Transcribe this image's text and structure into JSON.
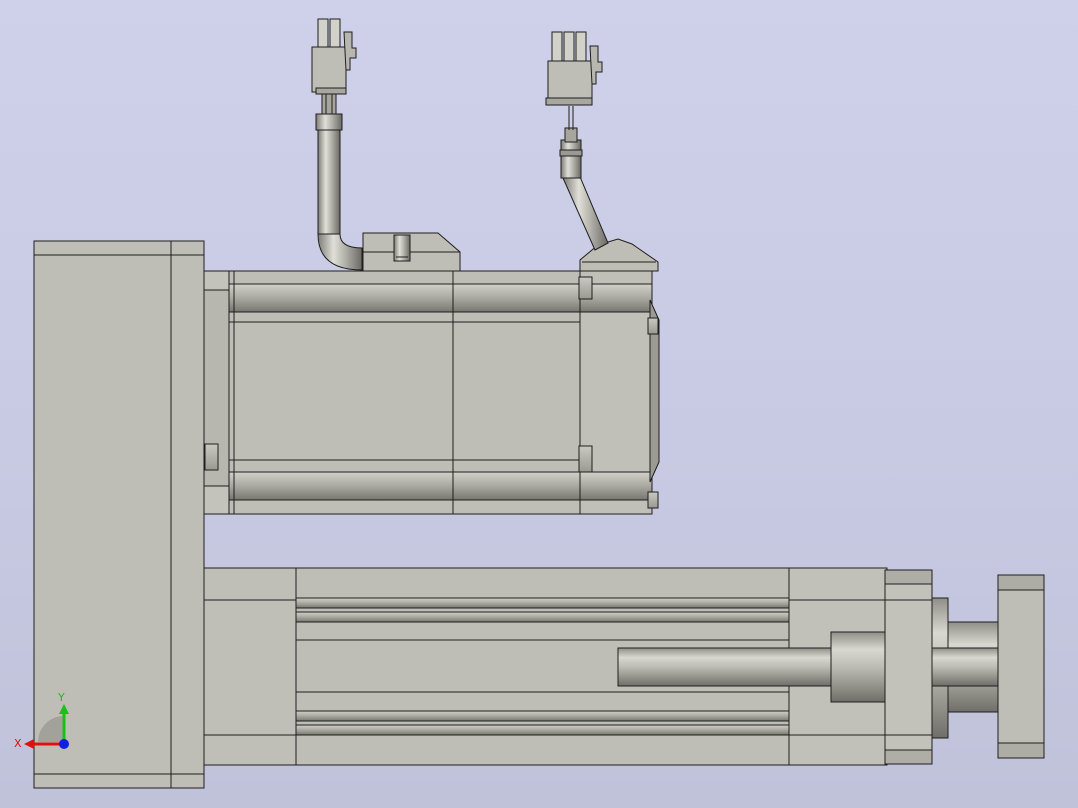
{
  "triad": {
    "x_label": "X",
    "y_label": "Y",
    "x_color": "#e01010",
    "y_color": "#18c018",
    "z_color": "#1020e0"
  },
  "colors": {
    "background_top": "#cfd0ea",
    "background_bottom": "#c0c2da",
    "part_face": "#bfbeb6",
    "part_shadow": "#8c8b84",
    "edge": "#1e1e1e"
  }
}
